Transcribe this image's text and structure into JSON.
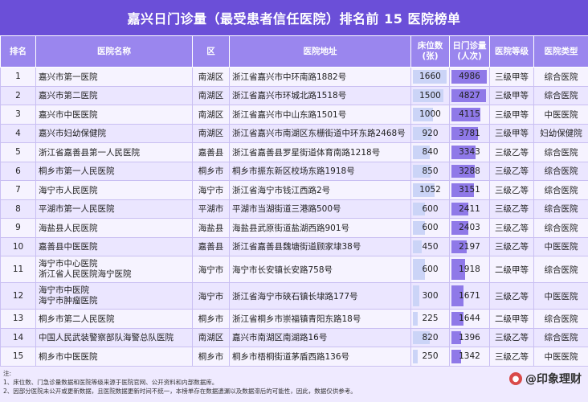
{
  "title": "嘉兴日门诊量（最受患者信任医院）排名前 15 医院榜单",
  "headers": {
    "rank": "排名",
    "name": "医院名称",
    "district": "区",
    "address": "医院地址",
    "beds_line1": "床位数",
    "beds_line2": "(张)",
    "visits_line1": "日门诊量",
    "visits_line2": "(人次)",
    "level": "医院等级",
    "type": "医院类型"
  },
  "rows": [
    {
      "rank": "1",
      "name": "嘉兴市第一医院",
      "name2": "",
      "district": "南湖区",
      "address": "浙江省嘉兴市中环南路1882号",
      "beds": "1660",
      "beds_num": 1660,
      "visits": "4986",
      "visits_num": 4986,
      "level": "三级甲等",
      "type": "综合医院"
    },
    {
      "rank": "2",
      "name": "嘉兴市第二医院",
      "name2": "",
      "district": "南湖区",
      "address": "浙江省嘉兴市环城北路1518号",
      "beds": "1500",
      "beds_num": 1500,
      "visits": "4827",
      "visits_num": 4827,
      "level": "三级甲等",
      "type": "综合医院"
    },
    {
      "rank": "3",
      "name": "嘉兴市中医医院",
      "name2": "",
      "district": "南湖区",
      "address": "浙江省嘉兴市中山东路1501号",
      "beds": "1000",
      "beds_num": 1000,
      "visits": "4115",
      "visits_num": 4115,
      "level": "三级甲等",
      "type": "中医医院"
    },
    {
      "rank": "4",
      "name": "嘉兴市妇幼保健院",
      "name2": "",
      "district": "南湖区",
      "address": "浙江省嘉兴市南湖区东栅街道中环东路2468号",
      "beds": "920",
      "beds_num": 920,
      "visits": "3781",
      "visits_num": 3781,
      "level": "三级甲等",
      "type": "妇幼保健院"
    },
    {
      "rank": "5",
      "name": "浙江省嘉善县第一人民医院",
      "name2": "",
      "district": "嘉善县",
      "address": "浙江省嘉善县罗星街道体育南路1218号",
      "beds": "840",
      "beds_num": 840,
      "visits": "3343",
      "visits_num": 3343,
      "level": "三级乙等",
      "type": "综合医院"
    },
    {
      "rank": "6",
      "name": "桐乡市第一人民医院",
      "name2": "",
      "district": "桐乡市",
      "address": "桐乡市振东新区校场东路1918号",
      "beds": "850",
      "beds_num": 850,
      "visits": "3288",
      "visits_num": 3288,
      "level": "三级乙等",
      "type": "综合医院"
    },
    {
      "rank": "7",
      "name": "海宁市人民医院",
      "name2": "",
      "district": "海宁市",
      "address": "浙江省海宁市钱江西路2号",
      "beds": "1052",
      "beds_num": 1052,
      "visits": "3151",
      "visits_num": 3151,
      "level": "三级乙等",
      "type": "综合医院"
    },
    {
      "rank": "8",
      "name": "平湖市第一人民医院",
      "name2": "",
      "district": "平湖市",
      "address": "平湖市当湖街道三港路500号",
      "beds": "600",
      "beds_num": 600,
      "visits": "2411",
      "visits_num": 2411,
      "level": "三级乙等",
      "type": "综合医院"
    },
    {
      "rank": "9",
      "name": "海盐县人民医院",
      "name2": "",
      "district": "海盐县",
      "address": "海盐县武原街道盐湖西路901号",
      "beds": "600",
      "beds_num": 600,
      "visits": "2403",
      "visits_num": 2403,
      "level": "三级乙等",
      "type": "综合医院"
    },
    {
      "rank": "10",
      "name": "嘉善县中医医院",
      "name2": "",
      "district": "嘉善县",
      "address": "浙江省嘉善县魏塘街道顾家埭38号",
      "beds": "450",
      "beds_num": 450,
      "visits": "2197",
      "visits_num": 2197,
      "level": "三级乙等",
      "type": "中医医院"
    },
    {
      "rank": "11",
      "name": "海宁市中心医院",
      "name2": "浙江省人民医院海宁医院",
      "district": "海宁市",
      "address": "海宁市长安镇长安路758号",
      "beds": "600",
      "beds_num": 600,
      "visits": "1918",
      "visits_num": 1918,
      "level": "二级甲等",
      "type": "综合医院"
    },
    {
      "rank": "12",
      "name": "海宁市中医院",
      "name2": "海宁市肿瘤医院",
      "district": "海宁市",
      "address": "浙江省海宁市硖石镇长埭路177号",
      "beds": "300",
      "beds_num": 300,
      "visits": "1671",
      "visits_num": 1671,
      "level": "三级乙等",
      "type": "中医医院"
    },
    {
      "rank": "13",
      "name": "桐乡市第二人民医院",
      "name2": "",
      "district": "桐乡市",
      "address": "浙江省桐乡市崇福镇青阳东路18号",
      "beds": "225",
      "beds_num": 225,
      "visits": "1644",
      "visits_num": 1644,
      "level": "二级甲等",
      "type": "综合医院"
    },
    {
      "rank": "14",
      "name": "中国人民武装警察部队海警总队医院",
      "name2": "",
      "district": "南湖区",
      "address": "嘉兴市南湖区南湖路16号",
      "beds": "820",
      "beds_num": 820,
      "visits": "1396",
      "visits_num": 1396,
      "level": "三级乙等",
      "type": "综合医院"
    },
    {
      "rank": "15",
      "name": "桐乡市中医医院",
      "name2": "",
      "district": "桐乡市",
      "address": "桐乡市梧桐街道茅盾西路136号",
      "beds": "250",
      "beds_num": 250,
      "visits": "1342",
      "visits_num": 1342,
      "level": "三级乙等",
      "type": "中医医院"
    }
  ],
  "notes": {
    "label": "注:",
    "line1": "1、床位数、门急诊量数据和医院等级来源于医院官网、公开资料和内部数据库。",
    "line2": "2、因部分医院未公开或更新数据，且医院数据更新时间不统一，本榜单存在数据遗漏以及数据滞后的可能性，因此，数据仅供参考。"
  },
  "logo": {
    "text": "@印象理财",
    "icon": "weibo-icon"
  },
  "colors": {
    "header": "#6b4fd8",
    "subheader": "#9a86ee",
    "visit_bar": "#8f79e8",
    "bed_bar": "#cbd4f7"
  }
}
